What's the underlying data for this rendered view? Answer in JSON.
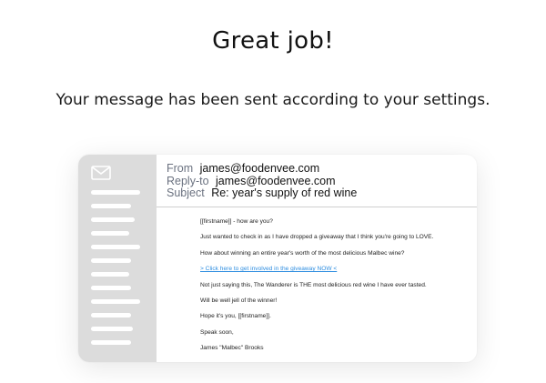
{
  "heading": "Great job!",
  "subheading": "Your message has been sent according to your settings.",
  "email": {
    "from_label": "From",
    "from_value": "james@foodenvee.com",
    "replyto_label": "Reply-to",
    "replyto_value": "james@foodenvee.com",
    "subject_label": "Subject",
    "subject_value": "Re: year's supply of red wine",
    "body": {
      "greeting": "[[firstname]] - how are you?",
      "p1": "Just wanted to check in as I have dropped a giveaway that I think you're going to LOVE.",
      "p2": "How about winning an entire year's worth of the most delicious Malbec wine?",
      "link": "> Click here to get involved in the giveaway NOW <",
      "p3": "Not just saying this, The Wanderer is THE most delicious red wine I have ever tasted.",
      "p4": "Will be well jell of the winner!",
      "p5": "Hope it's you, [[firstname]].",
      "p6": "Speak soon,",
      "signature": "James \"Malbec\" Brooks"
    }
  },
  "colors": {
    "sidebar_bg": "#dcdcdc",
    "link": "#2f8ee0",
    "label_gray": "#6b7280"
  },
  "icons": {
    "envelope": "envelope-icon"
  }
}
